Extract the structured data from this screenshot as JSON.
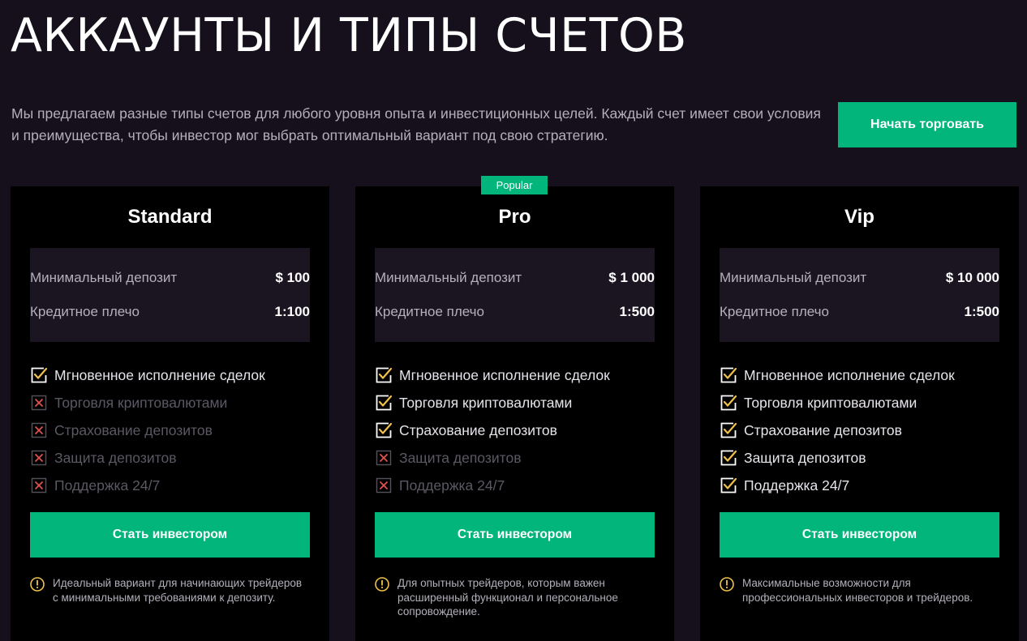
{
  "header": {
    "title": "АККАУНТЫ И ТИПЫ СЧЕТОВ",
    "intro": "Мы предлагаем разные типы счетов для любого уровня опыта и инвестиционных целей. Каждый счет имеет свои условия и преимущества, чтобы инвестор мог выбрать оптимальный вариант под свою стратегию.",
    "cta_label": "Начать торговать"
  },
  "badge": {
    "label": "Popular"
  },
  "colors": {
    "accent": "#02b57a",
    "check": "#f0c14b",
    "cross": "#e0524b",
    "background": "#15101b",
    "card": "#000000"
  },
  "icons": {
    "included": "check-icon",
    "excluded": "cross-icon",
    "note": "warning-icon"
  },
  "plans": [
    {
      "name": "Standard",
      "specs": [
        {
          "label": "Минимальный депозит",
          "value": "$ 100"
        },
        {
          "label": "Кредитное плечо",
          "value": "1:100"
        }
      ],
      "features": [
        {
          "label": "Мгновенное исполнение сделок",
          "included": true
        },
        {
          "label": "Торговля криптовалютами",
          "included": false
        },
        {
          "label": "Страхование депозитов",
          "included": false
        },
        {
          "label": "Защита депозитов",
          "included": false
        },
        {
          "label": "Поддержка 24/7",
          "included": false
        }
      ],
      "button_label": "Стать инвестором",
      "note": "Идеальный вариант для начинающих трейдеров с минимальными требованиями к депозиту."
    },
    {
      "name": "Pro",
      "specs": [
        {
          "label": "Минимальный депозит",
          "value": "$ 1 000"
        },
        {
          "label": "Кредитное плечо",
          "value": "1:500"
        }
      ],
      "features": [
        {
          "label": "Мгновенное исполнение сделок",
          "included": true
        },
        {
          "label": "Торговля криптовалютами",
          "included": true
        },
        {
          "label": "Страхование депозитов",
          "included": true
        },
        {
          "label": "Защита депозитов",
          "included": false
        },
        {
          "label": "Поддержка 24/7",
          "included": false
        }
      ],
      "button_label": "Стать инвестором",
      "note": "Для опытных трейдеров, которым важен расширенный функционал и персональное сопровождение."
    },
    {
      "name": "Vip",
      "specs": [
        {
          "label": "Минимальный депозит",
          "value": "$ 10 000"
        },
        {
          "label": "Кредитное плечо",
          "value": "1:500"
        }
      ],
      "features": [
        {
          "label": "Мгновенное исполнение сделок",
          "included": true
        },
        {
          "label": "Торговля криптовалютами",
          "included": true
        },
        {
          "label": "Страхование депозитов",
          "included": true
        },
        {
          "label": "Защита депозитов",
          "included": true
        },
        {
          "label": "Поддержка 24/7",
          "included": true
        }
      ],
      "button_label": "Стать инвестором",
      "note": "Максимальные возможности для профессиональных инвесторов и трейдеров."
    }
  ]
}
